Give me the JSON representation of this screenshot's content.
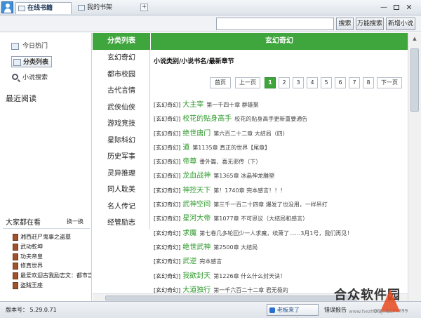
{
  "titlebar": {
    "tabs": [
      {
        "label": "在线书籍"
      },
      {
        "label": "我的书架"
      }
    ],
    "add_tab": "+",
    "controls": {
      "minimize": "—",
      "close": "✕"
    }
  },
  "toolbar": {
    "search_value": "",
    "search_button": "搜索",
    "all_search_button": "万能搜索",
    "add_novel_button": "新增小说"
  },
  "sidebar": {
    "nav": [
      {
        "label": "今日热门"
      },
      {
        "label": "分类列表"
      },
      {
        "label": "小说搜索"
      }
    ],
    "recent_title": "最近阅读",
    "everyone_title": "大家都在看",
    "shuffle": "换一换",
    "books": [
      "湘西赶尸鬼事之盗墓",
      "武动乾坤",
      "功夫帝皇",
      "修真世界",
      "最爱欢迎古我励志文：都市岂能安宁",
      "盗賊王座"
    ]
  },
  "categories": {
    "header": "分类列表",
    "items": [
      "玄幻奇幻",
      "都市校园",
      "古代言情",
      "武侠仙侠",
      "游戏竞技",
      "星际科幻",
      "历史军事",
      "灵异推理",
      "同人耽美",
      "名人传记",
      "经管励志"
    ]
  },
  "main": {
    "header": "玄幻奇幻",
    "subheader": "小说类别/小说书名/最新章节",
    "pager": {
      "first": "首页",
      "prev": "上一页",
      "pages": [
        "1",
        "2",
        "3",
        "4",
        "5",
        "6",
        "7",
        "8"
      ],
      "next": "下一页",
      "active": "1"
    },
    "rows": [
      {
        "cat": "[玄幻奇幻]",
        "title": "大主宰",
        "chapter": "第一千四十章 群雄聚"
      },
      {
        "cat": "[玄幻奇幻]",
        "title": "校花的贴身高手",
        "chapter": "校花的贴身高手更新重要通告"
      },
      {
        "cat": "[玄幻奇幻]",
        "title": "绝世唐门",
        "chapter": "第六百二十二章 大结局（四）"
      },
      {
        "cat": "[玄幻奇幻]",
        "title": "道",
        "chapter": "第1135章 真正的世界【尾章】"
      },
      {
        "cat": "[玄幻奇幻]",
        "title": "帝尊",
        "chapter": "番外篇、喜无邪传（下）"
      },
      {
        "cat": "[玄幻奇幻]",
        "title": "龙血战神",
        "chapter": "第1365章 冰晶神龙雕塑"
      },
      {
        "cat": "[玄幻奇幻]",
        "title": "神控天下",
        "chapter": "第！1740章 完本感言！！！"
      },
      {
        "cat": "[玄幻奇幻]",
        "title": "武神空间",
        "chapter": "第三千一百二十四章 爆发了也没用，一样吊打"
      },
      {
        "cat": "[玄幻奇幻]",
        "title": "星河大帝",
        "chapter": "第1077章 不可思议（大结局和感言）"
      },
      {
        "cat": "[玄幻奇幻]",
        "title": "求魔",
        "chapter": "第七卷几多轮回少一人求魔，续萧了……3月1号，我们再见！"
      },
      {
        "cat": "[玄幻奇幻]",
        "title": "绝世武神",
        "chapter": "第2500章 大结局"
      },
      {
        "cat": "[玄幻奇幻]",
        "title": "武逆",
        "chapter": "完本感言"
      },
      {
        "cat": "[玄幻奇幻]",
        "title": "我欲封天",
        "chapter": "第1226章 什么什么封天诀！"
      },
      {
        "cat": "[玄幻奇幻]",
        "title": "大道独行",
        "chapter": "第一千六百二十二章 君无极的"
      }
    ]
  },
  "statusbar": {
    "version": "版本号： 5.29.0.71",
    "boss_key": "老板来了CTRL+`",
    "report": "错误报告",
    "qq": "QQ：1530699"
  },
  "watermark": {
    "text": "合众软件园",
    "url": "www.hezhong.net"
  }
}
